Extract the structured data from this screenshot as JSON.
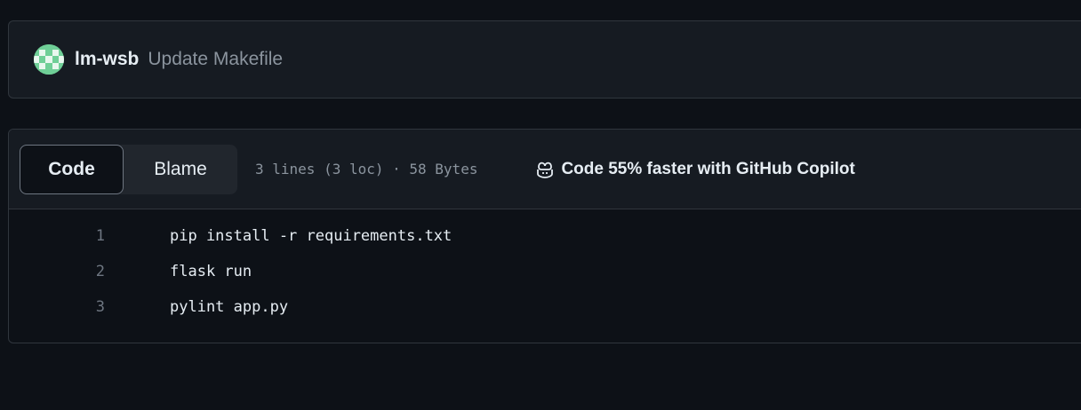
{
  "commit": {
    "author": "lm-wsb",
    "message": "Update Makefile",
    "avatar_icon": "identicon-avatar"
  },
  "file": {
    "tabs": [
      {
        "label": "Code",
        "active": true
      },
      {
        "label": "Blame",
        "active": false
      }
    ],
    "meta": "3 lines (3 loc) · 58 Bytes",
    "copilot_icon": "copilot-icon",
    "copilot_label": "Code 55% faster with GitHub Copilot",
    "lines": [
      {
        "number": "1",
        "code": "pip install -r requirements.txt"
      },
      {
        "number": "2",
        "code": "flask run"
      },
      {
        "number": "3",
        "code": "pylint app.py"
      }
    ]
  },
  "colors": {
    "background": "#0d1117",
    "panel": "#161b22",
    "border": "#30363d",
    "muted_text": "#8b949e",
    "text": "#e6edf3",
    "avatar": "#6fcf97"
  }
}
